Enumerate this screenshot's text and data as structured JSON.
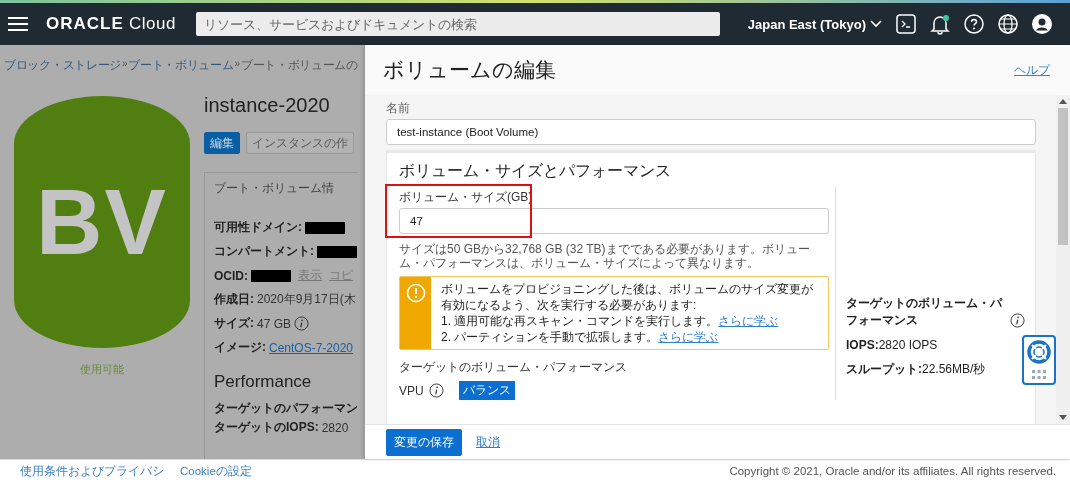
{
  "header": {
    "brand": "ORACLE",
    "product": "Cloud",
    "search": {
      "placeholder": "リソース、サービスおよびドキュメントの検索"
    },
    "region": "Japan East (Tokyo)",
    "notification": true
  },
  "page": {
    "breadcrumbs": [
      "ブロック・ストレージ",
      "ブート・ボリューム",
      "ブート・ボリュームの"
    ],
    "separator": "»",
    "tile": {
      "letters": "BV",
      "status": "使用可能"
    },
    "title": "instance-2020",
    "buttons": [
      {
        "label": "編集",
        "kind": "primary"
      },
      {
        "label": "インスタンスの作",
        "kind": "secondary"
      }
    ],
    "info_card": {
      "title": "ブート・ボリューム情",
      "fields": [
        {
          "label": "可用性ドメイン:",
          "kind": "redacted"
        },
        {
          "label": "コンパートメント:",
          "kind": "redacted"
        },
        {
          "label": "OCID:",
          "kind": "redacted",
          "links": [
            "表示",
            "コピ"
          ]
        },
        {
          "label": "作成日:",
          "kind": "text",
          "value": "2020年9月17日(木"
        },
        {
          "label": "サイズ:",
          "kind": "info",
          "value": "47 GB"
        },
        {
          "label": "イメージ:",
          "kind": "link",
          "value": "CentOS-7-2020"
        }
      ],
      "performance_heading": "Performance",
      "performance_fields": [
        {
          "label": "ターゲットのパフォーマン"
        },
        {
          "label": "ターゲットのIOPS:",
          "value": "2820"
        }
      ]
    }
  },
  "panel": {
    "title": "ボリュームの編集",
    "help": "ヘルプ",
    "name": {
      "label": "名前",
      "value": "test-instance (Boot Volume)"
    },
    "section": {
      "title": "ボリューム・サイズとパフォーマンス",
      "size": {
        "label": "ボリューム・サイズ(GB)",
        "value": "47",
        "hint": "サイズは50 GBから32,768 GB (32 TB)までである必要があります。ボリューム・パフォーマンスは、ボリューム・サイズによって異なります。",
        "highlighted": true
      },
      "warning": {
        "text": "ボリュームをプロビジョニングした後は、ボリュームのサイズ変更が有効になるよう、次を実行する必要があります:",
        "steps": [
          {
            "text": "1. 適用可能な再スキャン・コマンドを実行します。",
            "link": "さらに学ぶ"
          },
          {
            "text": "2. パーティションを手動で拡張します。",
            "link": "さらに学ぶ"
          }
        ]
      },
      "target_heading": "ターゲットのボリューム・パフォーマンス",
      "vpu": {
        "label": "VPU",
        "option": "バランス"
      },
      "summary": {
        "heading": "ターゲットのボリューム・パフォーマンス",
        "fields": [
          {
            "label": "IOPS:",
            "value": "2820 IOPS"
          },
          {
            "label": "スループット:",
            "value": "22.56MB/秒"
          }
        ]
      }
    },
    "actions": {
      "save": "変更の保存",
      "cancel": "取消"
    }
  },
  "footer": {
    "links": [
      "使用条件およびプライバシ",
      "Cookieの設定"
    ],
    "copyright": "Copyright © 2021, Oracle and/or its affiliates. All rights reserved."
  }
}
